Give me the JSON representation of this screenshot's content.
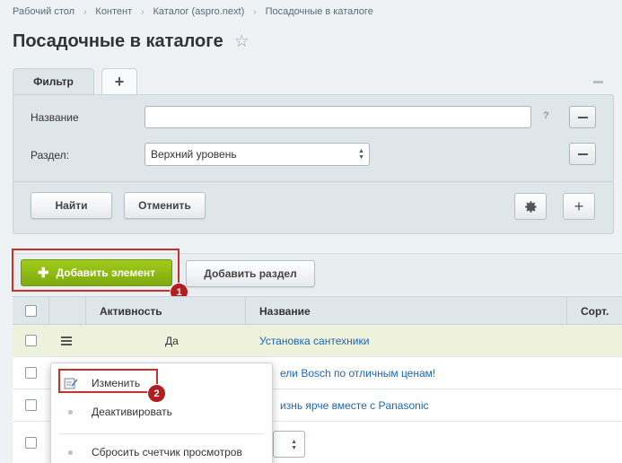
{
  "breadcrumb": [
    "Рабочий стол",
    "Контент",
    "Каталог (aspro.next)",
    "Посадочные в каталоге"
  ],
  "page_title": "Посадочные в каталоге",
  "filter": {
    "tab_label": "Фильтр",
    "tab_add": "+",
    "name_label": "Название",
    "name_value": "",
    "help": "?",
    "section_label": "Раздел:",
    "section_value": "Верхний уровень",
    "find_button": "Найти",
    "cancel_button": "Отменить"
  },
  "toolbar": {
    "add_element": "Добавить элемент",
    "add_section": "Добавить раздел",
    "badge1": "1",
    "badge2": "2"
  },
  "table": {
    "columns": [
      "Активность",
      "Название",
      "Сорт."
    ],
    "rows": [
      {
        "active": "Да",
        "name": "Установка сантехники"
      },
      {
        "active": "",
        "name": "ели Bosch по отличным ценам!"
      },
      {
        "active": "",
        "name": "изнь ярче вместе с Panasonic"
      }
    ]
  },
  "context_menu": {
    "items": [
      "Изменить",
      "Деактивировать",
      "Сбросить счетчик просмотров"
    ]
  },
  "colors": {
    "accent_green": "#8cb814",
    "annotation_red": "#c4322a",
    "link": "#2067b0"
  }
}
